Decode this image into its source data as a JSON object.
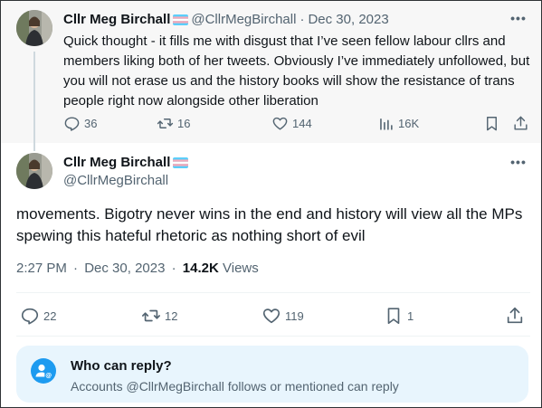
{
  "parent_tweet": {
    "display_name": "Cllr Meg Birchall",
    "handle": "@CllrMegBirchall",
    "separator": "·",
    "date": "Dec 30, 2023",
    "text": "Quick thought - it fills me with disgust that I’ve seen fellow labour cllrs and members liking both of her tweets. Obviously I’ve immediately unfollowed, but you will not erase us and the history books will show the resistance of trans people right now alongside other liberation",
    "replies": "36",
    "reposts": "16",
    "likes": "144",
    "views": "16K",
    "icons": [
      "reply-icon",
      "repost-icon",
      "like-icon",
      "views-icon",
      "bookmark-icon",
      "share-icon",
      "more-icon"
    ]
  },
  "main_tweet": {
    "display_name": "Cllr Meg Birchall",
    "handle": "@CllrMegBirchall",
    "text": "movements. Bigotry never wins in the end and history will view all the MPs spewing this hateful rhetoric as nothing short of evil",
    "time": "2:27 PM",
    "separator": "·",
    "date": "Dec 30, 2023",
    "separator2": "·",
    "views_count": "14.2K",
    "views_label": "Views",
    "replies": "22",
    "reposts": "12",
    "likes": "119",
    "bookmarks": "1"
  },
  "who_can_reply": {
    "title": "Who can reply?",
    "description": "Accounts @CllrMegBirchall follows or mentioned can reply"
  },
  "colors": {
    "muted_text": "#536471",
    "primary_text": "#0f1419",
    "accent_blue": "#1d9bf0",
    "reply_box_bg": "#e8f5fd",
    "trans_flag_blue": "#5bcefa",
    "trans_flag_pink": "#f5a9b8"
  }
}
